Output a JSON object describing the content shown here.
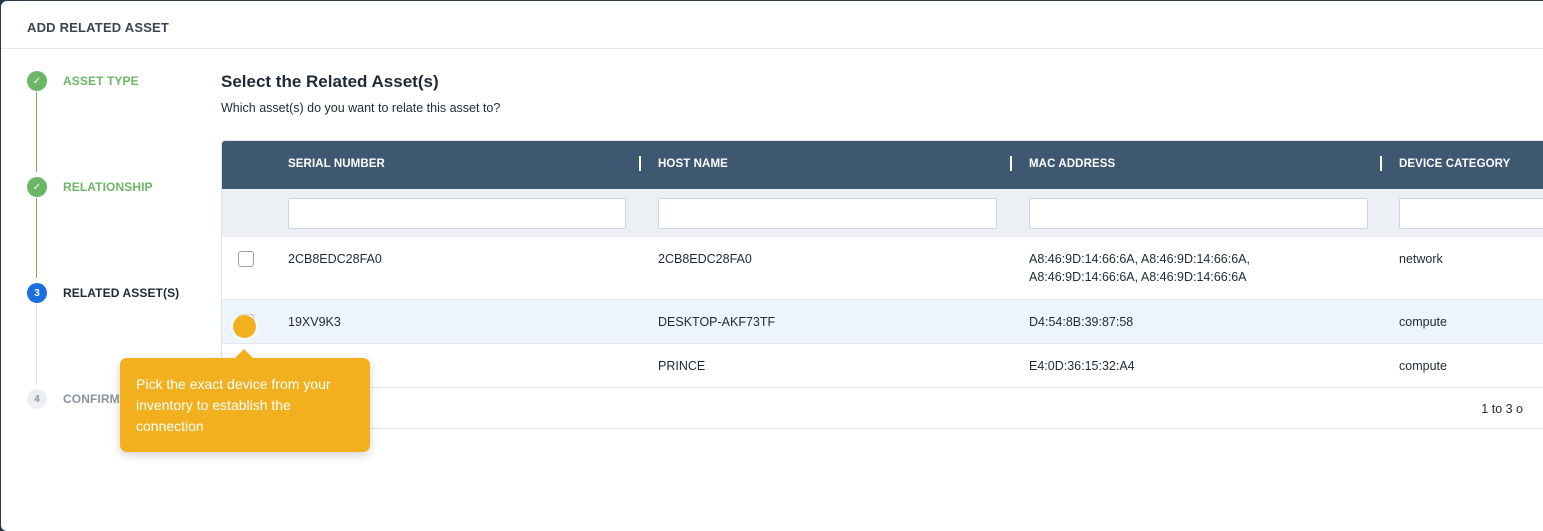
{
  "modal": {
    "title": "ADD RELATED ASSET"
  },
  "steps": [
    {
      "label": "ASSET TYPE",
      "state": "done",
      "marker": "✓"
    },
    {
      "label": "RELATIONSHIP",
      "state": "done",
      "marker": "✓"
    },
    {
      "label": "RELATED ASSET(S)",
      "state": "active",
      "marker": "3"
    },
    {
      "label": "CONFIRM",
      "state": "todo",
      "marker": "4"
    }
  ],
  "main": {
    "title": "Select the Related Asset(s)",
    "subtitle": "Which asset(s) do you want to relate this asset to?"
  },
  "grid": {
    "columns": [
      "SERIAL NUMBER",
      "HOST NAME",
      "MAC ADDRESS",
      "DEVICE CATEGORY"
    ],
    "filters": [
      "",
      "",
      "",
      ""
    ],
    "rows": [
      {
        "serial": "2CB8EDC28FA0",
        "host": "2CB8EDC28FA0",
        "mac": "A8:46:9D:14:66:6A, A8:46:9D:14:66:6A, A8:46:9D:14:66:6A, A8:46:9D:14:66:6A",
        "category": "network",
        "checked": false
      },
      {
        "serial": "19XV9K3",
        "host": "DESKTOP-AKF73TF",
        "mac": "D4:54:8B:39:87:58",
        "category": "compute",
        "checked": false
      },
      {
        "serial": "",
        "host": "PRINCE",
        "mac": "E4:0D:36:15:32:A4",
        "category": "compute",
        "checked": false
      }
    ],
    "pager_text": "1 to 3 o"
  },
  "tooltip": {
    "text": "Pick the exact device from your inventory to establish the connection"
  },
  "colors": {
    "header_bg": "#3f5871",
    "done": "#6cb766",
    "active": "#1d6fe0",
    "tooltip": "#f2b01e"
  }
}
